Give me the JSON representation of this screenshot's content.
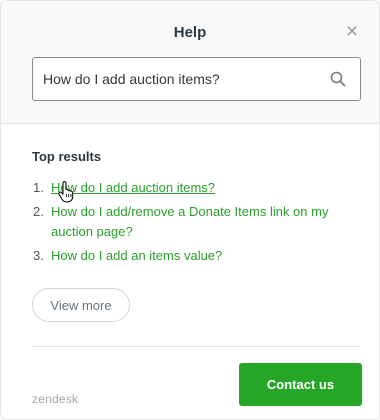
{
  "header": {
    "title": "Help",
    "close_icon": "close-icon",
    "close_glyph": "×"
  },
  "search": {
    "value": "How do I add auction items?",
    "icon": "search-icon"
  },
  "results": {
    "heading": "Top results",
    "items": [
      {
        "number": "1.",
        "label": "How do I add auction items?"
      },
      {
        "number": "2.",
        "label": "How do I add/remove a Donate Items link on my auction page?"
      },
      {
        "number": "3.",
        "label": "How do I add an items value?"
      }
    ],
    "view_more_label": "View more"
  },
  "footer": {
    "brand": "zendesk",
    "contact_label": "Contact us"
  },
  "colors": {
    "accent": "#26a626",
    "link": "#2a9f2a",
    "text": "#2f3941"
  }
}
